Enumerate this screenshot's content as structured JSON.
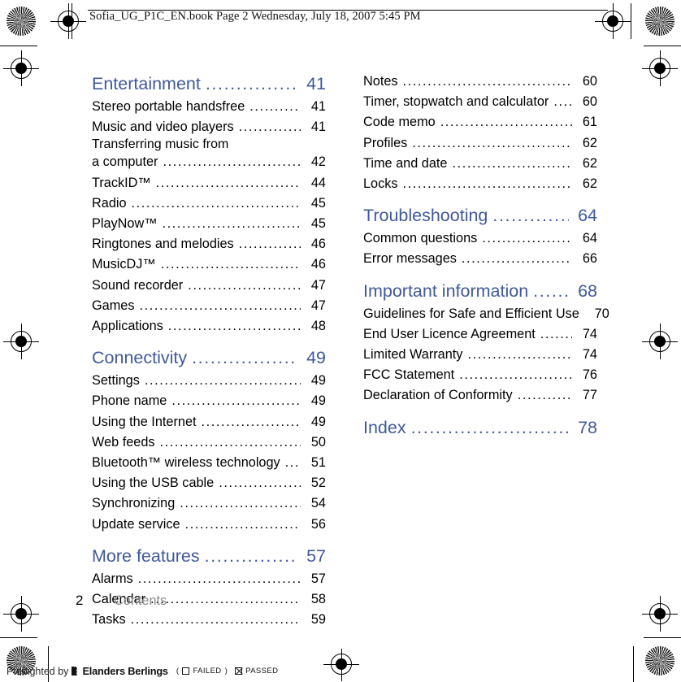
{
  "header": {
    "text": "Sofia_UG_P1C_EN.book  Page 2  Wednesday, July 18, 2007  5:45 PM"
  },
  "footer": {
    "page_number": "2",
    "section_label": "Contents",
    "preflight_prefix": "Preflighted by",
    "preflight_brand": "Elanders Berlings",
    "preflight_open_paren": "(",
    "preflight_failed_label": "FAILED",
    "preflight_close_paren": ")",
    "preflight_passed_label": "PASSED"
  },
  "colors": {
    "heading_blue": "#41599b",
    "body_black": "#000000",
    "footer_gray": "#8c8c8c"
  },
  "toc": {
    "left_column": [
      {
        "type": "heading",
        "label": "Entertainment",
        "page": "41"
      },
      {
        "type": "entry",
        "label": "Stereo portable handsfree",
        "page": "41"
      },
      {
        "type": "entry",
        "label": "Music and video players",
        "page": "41"
      },
      {
        "type": "contline",
        "label": "Transferring music from",
        "page": ""
      },
      {
        "type": "entry",
        "label": "a computer",
        "page": "42"
      },
      {
        "type": "entry",
        "label": "TrackID™",
        "page": "44"
      },
      {
        "type": "entry",
        "label": "Radio",
        "page": "45"
      },
      {
        "type": "entry",
        "label": "PlayNow™",
        "page": "45"
      },
      {
        "type": "entry",
        "label": "Ringtones and melodies",
        "page": "46"
      },
      {
        "type": "entry",
        "label": "MusicDJ™",
        "page": "46"
      },
      {
        "type": "entry",
        "label": "Sound recorder",
        "page": "47"
      },
      {
        "type": "entry",
        "label": "Games",
        "page": "47"
      },
      {
        "type": "entry",
        "label": "Applications",
        "page": "48"
      },
      {
        "type": "heading",
        "label": "Connectivity",
        "page": "49"
      },
      {
        "type": "entry",
        "label": "Settings",
        "page": "49"
      },
      {
        "type": "entry",
        "label": "Phone name",
        "page": "49"
      },
      {
        "type": "entry",
        "label": "Using the Internet",
        "page": "49"
      },
      {
        "type": "entry",
        "label": "Web feeds",
        "page": "50"
      },
      {
        "type": "entry",
        "label": "Bluetooth™ wireless technology",
        "page": "51"
      },
      {
        "type": "entry",
        "label": "Using the USB cable",
        "page": "52"
      },
      {
        "type": "entry",
        "label": "Synchronizing",
        "page": "54"
      },
      {
        "type": "entry",
        "label": "Update service",
        "page": "56"
      },
      {
        "type": "heading",
        "label": "More features",
        "page": "57"
      },
      {
        "type": "entry",
        "label": "Alarms",
        "page": "57"
      },
      {
        "type": "entry",
        "label": "Calendar",
        "page": "58"
      },
      {
        "type": "entry",
        "label": "Tasks",
        "page": "59"
      }
    ],
    "right_column": [
      {
        "type": "entry",
        "label": "Notes",
        "page": "60"
      },
      {
        "type": "entry",
        "label": "Timer, stopwatch and calculator",
        "page": "60"
      },
      {
        "type": "entry",
        "label": "Code memo",
        "page": "61"
      },
      {
        "type": "entry",
        "label": "Profiles",
        "page": "62"
      },
      {
        "type": "entry",
        "label": "Time and date",
        "page": "62"
      },
      {
        "type": "entry",
        "label": "Locks",
        "page": "62"
      },
      {
        "type": "heading",
        "label": "Troubleshooting",
        "page": "64"
      },
      {
        "type": "entry",
        "label": "Common questions",
        "page": "64"
      },
      {
        "type": "entry",
        "label": "Error messages",
        "page": "66"
      },
      {
        "type": "heading",
        "label": "Important information",
        "page": "68"
      },
      {
        "type": "entry",
        "label": "Guidelines for Safe and Efficient Use",
        "page": "70"
      },
      {
        "type": "entry",
        "label": "End User Licence Agreement",
        "page": "74"
      },
      {
        "type": "entry",
        "label": "Limited Warranty",
        "page": "74"
      },
      {
        "type": "entry",
        "label": "FCC Statement",
        "page": "76"
      },
      {
        "type": "entry",
        "label": "Declaration of Conformity",
        "page": "77"
      },
      {
        "type": "heading",
        "label": "Index",
        "page": "78"
      }
    ]
  }
}
